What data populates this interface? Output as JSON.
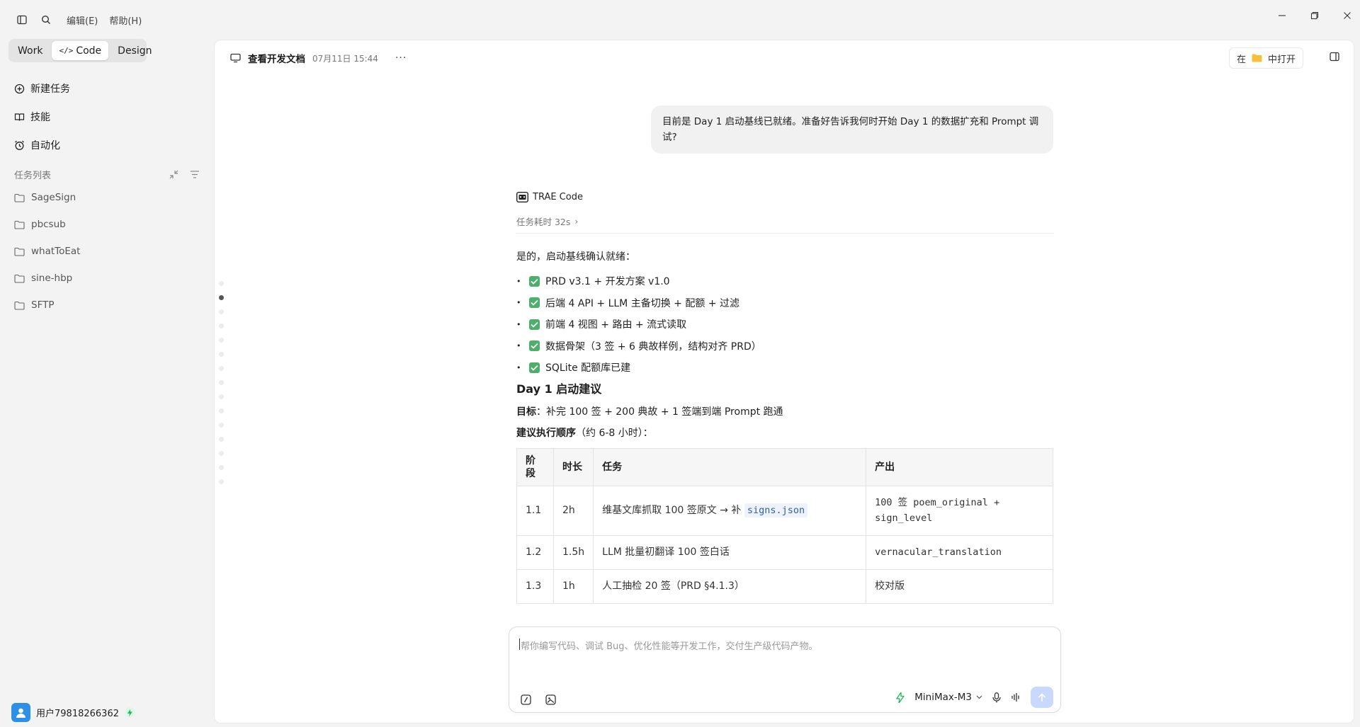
{
  "menu": {
    "edit": "编辑(E)",
    "help": "帮助(H)"
  },
  "modes": [
    "Work",
    "Code",
    "Design"
  ],
  "nav": {
    "new_task": "新建任务",
    "skills": "技能",
    "automation": "自动化"
  },
  "tasks": {
    "header": "任务列表",
    "items": [
      "SageSign",
      "pbcsub",
      "whatToEat",
      "sine-hbp",
      "SFTP"
    ]
  },
  "user": {
    "name": "用户79818266362"
  },
  "main": {
    "title": "查看开发文档",
    "time": "07月11日 15:44",
    "open_in_prefix": "在",
    "open_in_suffix": "中打开"
  },
  "conversation": {
    "user_message": "目前是 Day 1 启动基线已就绪。准备好告诉我何时开始 Day 1 的数据扩充和 Prompt 调试?",
    "agent_name": "TRAE Code",
    "duration": "任务耗时 32s",
    "intro": "是的，启动基线确认就绪：",
    "checks": [
      "PRD v3.1 + 开发方案 v1.0",
      "后端 4 API + LLM 主备切换 + 配额 + 过滤",
      "前端 4 视图 + 路由 + 流式读取",
      "数据骨架（3 签 + 6 典故样例，结构对齐 PRD）",
      "SQLite 配额库已建"
    ],
    "heading": "Day 1 启动建议",
    "goal_label": "目标",
    "goal_text": "：补完 100 签 + 200 典故 + 1 签端到端 Prompt 跑通",
    "order_label": "建议执行顺序",
    "order_text": "（约 6-8 小时）：",
    "table": {
      "headers": [
        "阶段",
        "时长",
        "任务",
        "产出"
      ],
      "rows": [
        {
          "stage": "1.1",
          "time": "2h",
          "task": "维基文库抓取 100 签原文 → 补 ",
          "task_code": "signs.json",
          "output": "100 签 poem_original + sign_level"
        },
        {
          "stage": "1.2",
          "time": "1.5h",
          "task": "LLM 批量初翻译 100 签白话",
          "task_code": "",
          "output": "vernacular_translation"
        },
        {
          "stage": "1.3",
          "time": "1h",
          "task": "人工抽检 20 签（PRD §4.1.3）",
          "task_code": "",
          "output": "校对版"
        }
      ]
    }
  },
  "composer": {
    "placeholder": "帮你编写代码、调试 Bug、优化性能等开发工作，交付生产级代码产物。",
    "model": "MiniMax-M3"
  },
  "colors": {
    "accent": "#2d8fe6",
    "check": "#4caf6a",
    "send": "#c9d8ff"
  }
}
